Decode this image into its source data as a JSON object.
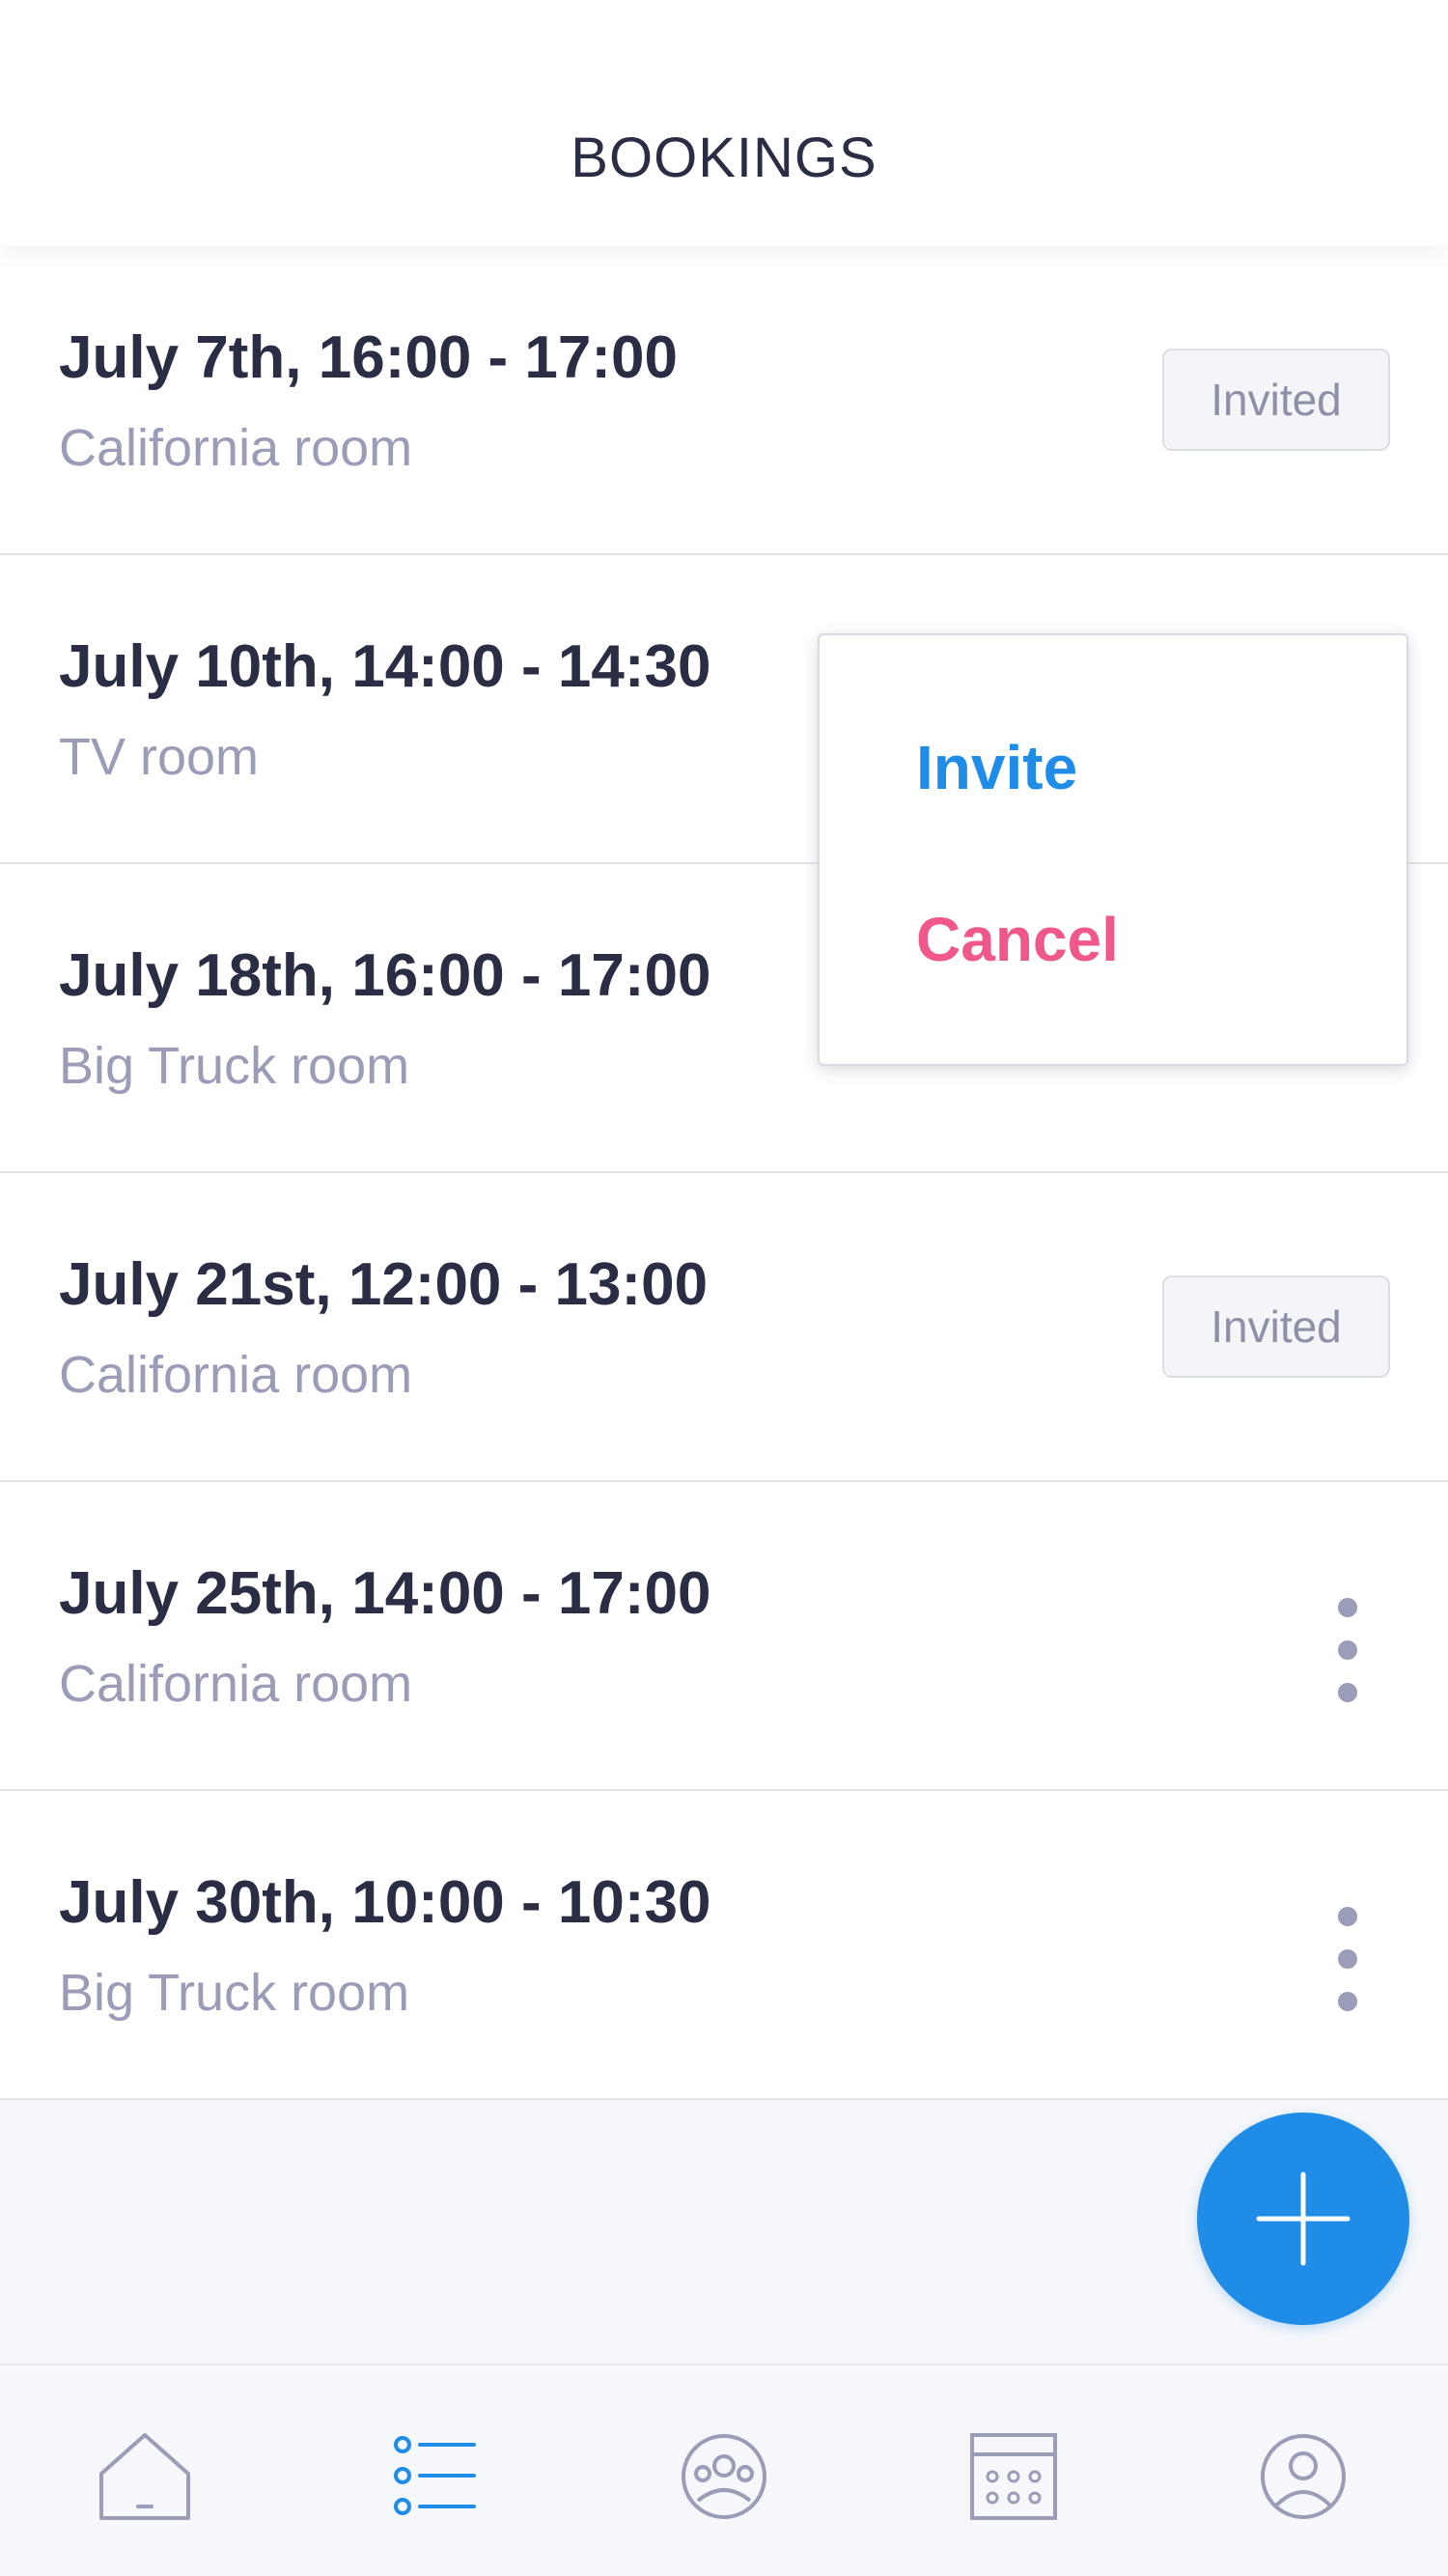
{
  "header": {
    "title": "BOOKINGS"
  },
  "bookings": [
    {
      "title": "July 7th, 16:00 - 17:00",
      "room": "California room",
      "status": "Invited"
    },
    {
      "title": "July 10th, 14:00 - 14:30",
      "room": "TV room",
      "status": ""
    },
    {
      "title": "July 18th, 16:00 - 17:00",
      "room": "Big Truck room",
      "status": ""
    },
    {
      "title": "July 21st, 12:00 - 13:00",
      "room": "California room",
      "status": "Invited"
    },
    {
      "title": "July 25th, 14:00 - 17:00",
      "room": "California room",
      "status": ""
    },
    {
      "title": "July 30th, 10:00 - 10:30",
      "room": "Big Truck room",
      "status": ""
    }
  ],
  "popup_menu": {
    "invite_label": "Invite",
    "cancel_label": "Cancel"
  },
  "fab": {
    "icon": "plus-icon"
  },
  "tabbar": {
    "tabs": [
      {
        "icon": "home-icon",
        "active": false
      },
      {
        "icon": "list-icon",
        "active": true
      },
      {
        "icon": "group-icon",
        "active": false
      },
      {
        "icon": "calendar-icon",
        "active": false
      },
      {
        "icon": "profile-icon",
        "active": false
      }
    ]
  },
  "colors": {
    "accent": "#1f8de8",
    "danger": "#f0588a",
    "text_primary": "#2b2d45",
    "text_secondary": "#9a9cb8",
    "icon_inactive": "#9a9cb8",
    "background": "#f6f7fa"
  }
}
